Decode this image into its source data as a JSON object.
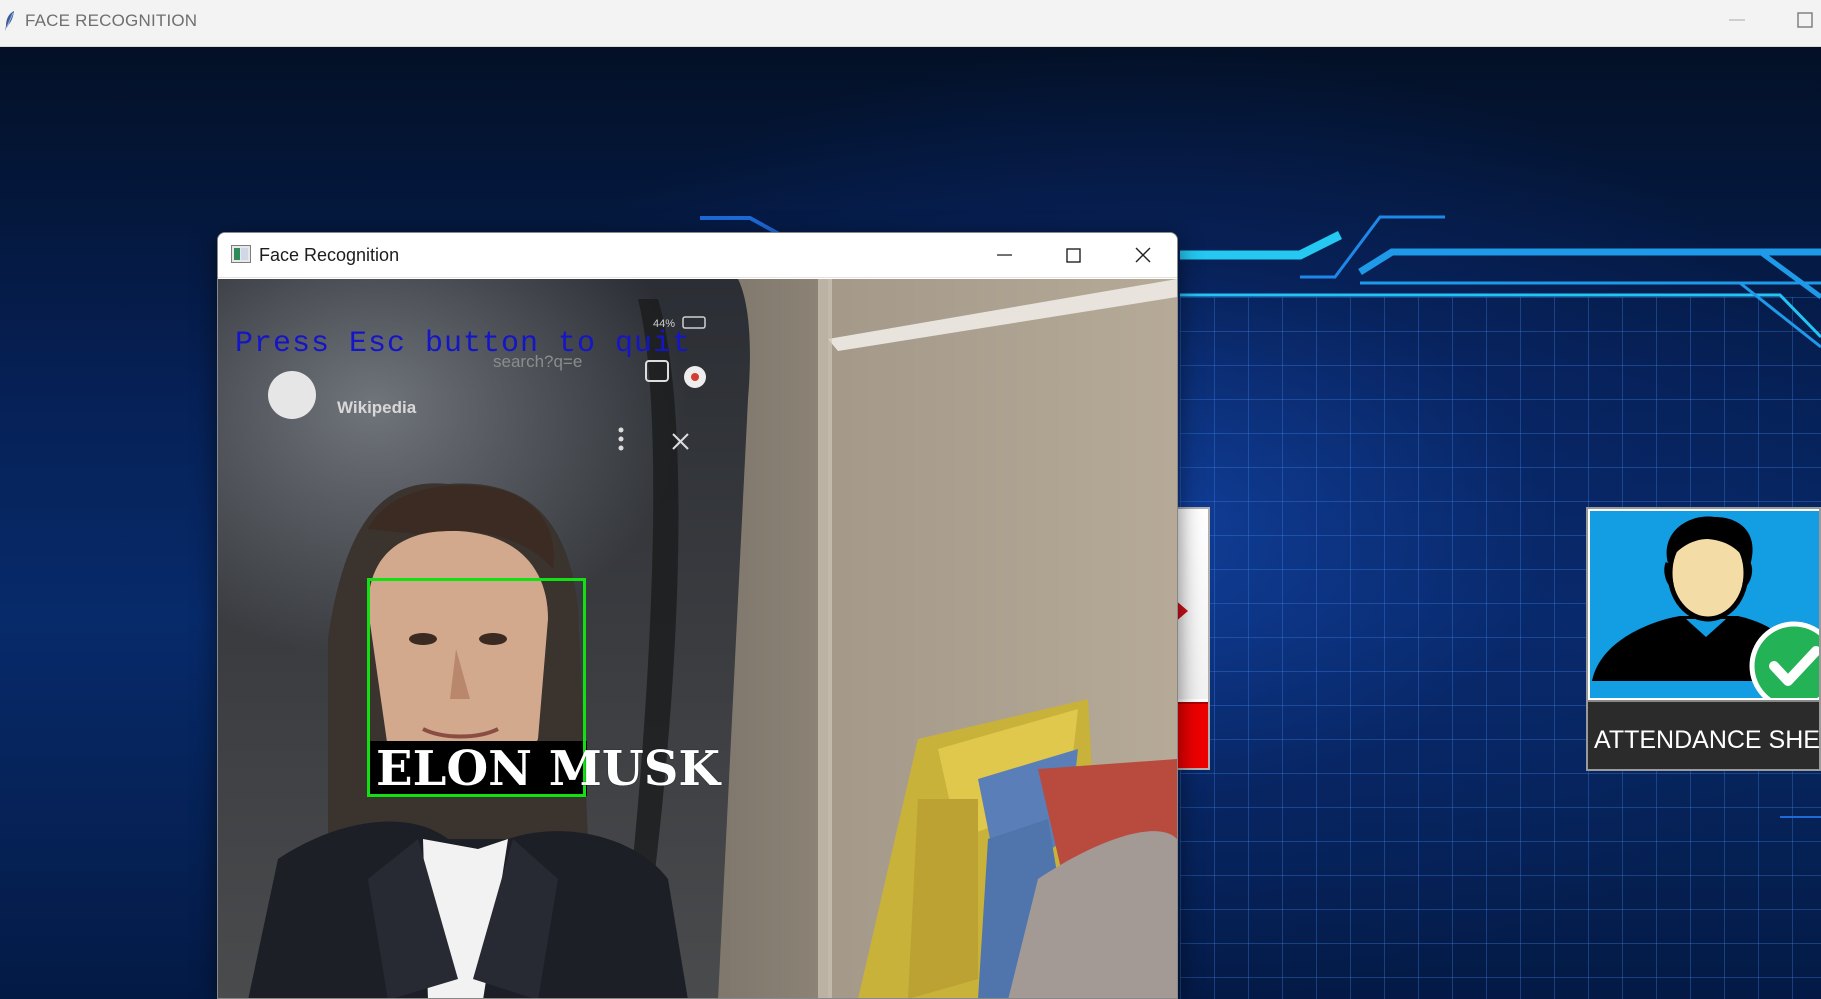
{
  "main_window": {
    "title": "FACE RECOGNITION",
    "minimize_icon": "minimize-icon",
    "maximize_icon": "maximize-icon"
  },
  "face_window": {
    "title": "Face Recognition",
    "controls": {
      "minimize": "minimize-icon",
      "maximize": "maximize-icon",
      "close": "close-icon"
    },
    "camera": {
      "instruction_text": "Press Esc button to quit",
      "recognized_name": "ELON MUSK",
      "box_color": "#12e012",
      "instruction_color": "#1515c8"
    },
    "phone_screen": {
      "url_fragment": "search?q=e",
      "site_label": "Wikipedia",
      "battery": "44%"
    }
  },
  "panels": {
    "attendance_label": "ATTENDANCE SHEE",
    "attendance_icon": "user-check-icon",
    "accent_red": "#ee0000",
    "accent_blue": "#139de3"
  }
}
